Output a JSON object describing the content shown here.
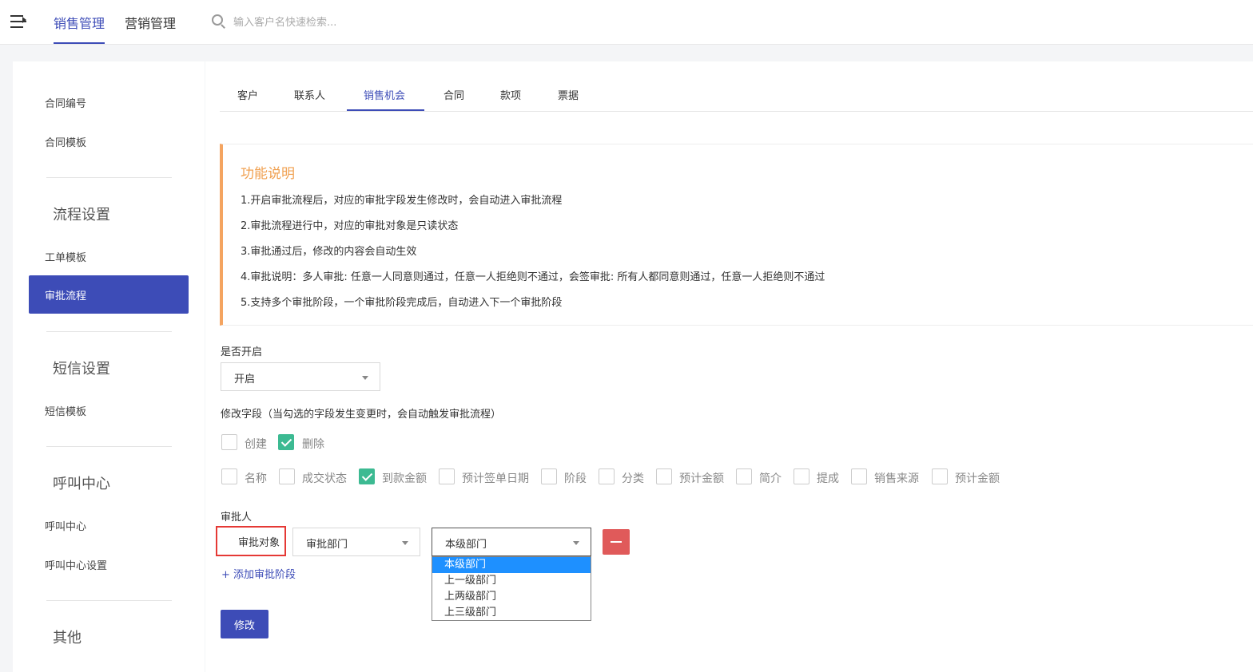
{
  "header": {
    "nav": [
      "销售管理",
      "营销管理"
    ],
    "search_placeholder": "输入客户名快速检索..."
  },
  "sidebar": {
    "items_top": [
      "合同编号",
      "合同模板"
    ],
    "sections": [
      {
        "title": "流程设置",
        "items": [
          "工单模板",
          "审批流程"
        ]
      },
      {
        "title": "短信设置",
        "items": [
          "短信模板"
        ]
      },
      {
        "title": "呼叫中心",
        "items": [
          "呼叫中心",
          "呼叫中心设置"
        ]
      },
      {
        "title": "其他",
        "items": []
      }
    ],
    "active_item": "审批流程"
  },
  "tabs": [
    "客户",
    "联系人",
    "销售机会",
    "合同",
    "款项",
    "票据"
  ],
  "active_tab": "销售机会",
  "notice": {
    "title": "功能说明",
    "lines": [
      "1.开启审批流程后，对应的审批字段发生修改时，会自动进入审批流程",
      "2.审批流程进行中，对应的审批对象是只读状态",
      "3.审批通过后，修改的内容会自动生效",
      "4.审批说明：多人审批: 任意一人同意则通过，任意一人拒绝则不通过，会签审批: 所有人都同意则通过，任意一人拒绝则不通过",
      "5.支持多个审批阶段，一个审批阶段完成后，自动进入下一个审批阶段"
    ]
  },
  "form": {
    "enable_label": "是否开启",
    "enable_value": "开启",
    "fields_label": "修改字段（当勾选的字段发生变更时，会自动触发审批流程）",
    "row1": [
      {
        "label": "创建",
        "checked": false
      },
      {
        "label": "删除",
        "checked": true
      }
    ],
    "row2": [
      {
        "label": "名称",
        "checked": false
      },
      {
        "label": "成交状态",
        "checked": false
      },
      {
        "label": "到款金额",
        "checked": true
      },
      {
        "label": "预计签单日期",
        "checked": false
      },
      {
        "label": "阶段",
        "checked": false
      },
      {
        "label": "分类",
        "checked": false
      },
      {
        "label": "预计金额",
        "checked": false
      },
      {
        "label": "简介",
        "checked": false
      },
      {
        "label": "提成",
        "checked": false
      },
      {
        "label": "销售来源",
        "checked": false
      },
      {
        "label": "预计金额",
        "checked": false
      }
    ],
    "approver_label": "审批人",
    "approval_target": "审批对象",
    "approval_type": "审批部门",
    "dept_value": "本级部门",
    "dept_options": [
      "本级部门",
      "上一级部门",
      "上两级部门",
      "上三级部门"
    ],
    "add_stage": "+ 添加审批阶段",
    "submit": "修改"
  },
  "colors": {
    "primary": "#3d4cb7",
    "checked": "#3cba92",
    "danger": "#e05a5a",
    "notice_accent": "#f4a460",
    "dropdown_highlight": "#1e90ff"
  }
}
